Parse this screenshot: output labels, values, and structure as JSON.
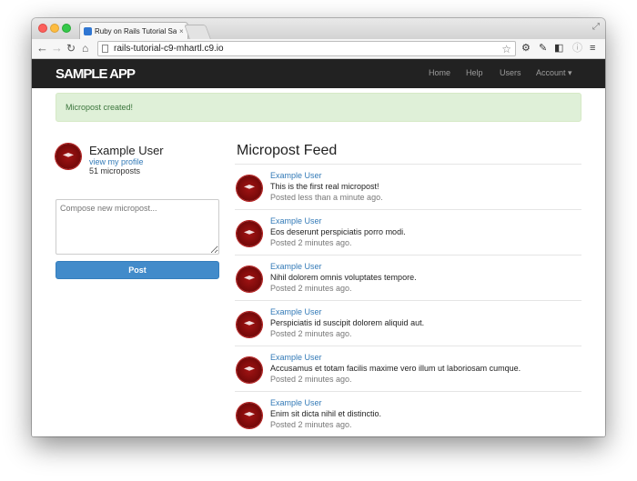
{
  "browser": {
    "tab_title": "Ruby on Rails Tutorial Sam",
    "tab_close": "×",
    "url": "rails-tutorial-c9-mhartl.c9.io"
  },
  "navbar": {
    "logo": "SAMPLE APP",
    "links": [
      "Home",
      "Help",
      "Users",
      "Account ▾"
    ]
  },
  "flash": {
    "message": "Micropost created!"
  },
  "profile": {
    "name": "Example User",
    "profile_link": "view my profile",
    "micropost_count": "51 microposts"
  },
  "compose": {
    "placeholder": "Compose new micropost...",
    "submit_label": "Post"
  },
  "feed": {
    "title": "Micropost Feed",
    "items": [
      {
        "user": "Example User",
        "content": "This is the first real micropost!",
        "time": "Posted less than a minute ago."
      },
      {
        "user": "Example User",
        "content": "Eos deserunt perspiciatis porro modi.",
        "time": "Posted 2 minutes ago."
      },
      {
        "user": "Example User",
        "content": "Nihil dolorem omnis voluptates tempore.",
        "time": "Posted 2 minutes ago."
      },
      {
        "user": "Example User",
        "content": "Perspiciatis id suscipit dolorem aliquid aut.",
        "time": "Posted 2 minutes ago."
      },
      {
        "user": "Example User",
        "content": "Accusamus et totam facilis maxime vero illum ut laboriosam cumque.",
        "time": "Posted 2 minutes ago."
      },
      {
        "user": "Example User",
        "content": "Enim sit dicta nihil et distinctio.",
        "time": "Posted 2 minutes ago."
      }
    ]
  },
  "colors": {
    "navbar_bg": "#222222",
    "link": "#337ab7",
    "alert_bg": "#dff0d8",
    "button": "#428bca",
    "avatar": "#8b0e0e"
  }
}
